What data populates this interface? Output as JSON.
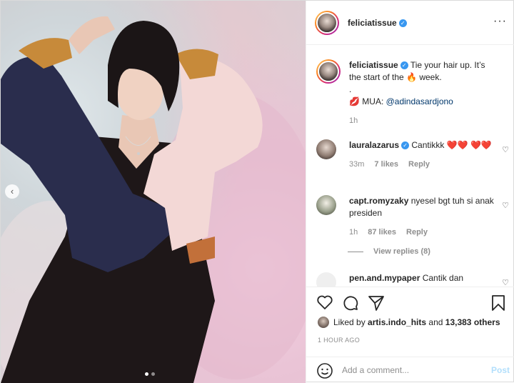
{
  "post": {
    "username": "feliciatissue",
    "verified": true,
    "more_icon": "more-dots-icon",
    "carousel_prev": "‹",
    "carousel_dots": 2,
    "carousel_active_index": 0
  },
  "caption": {
    "username": "feliciatissue",
    "text": "Tie your hair up. It’s the start of the 🔥 week.",
    "dot": ".",
    "mua_prefix": "💋 MUA: ",
    "mua_handle": "@adindasardjono",
    "time": "1h"
  },
  "comments": [
    {
      "username": "lauralazarus",
      "verified": true,
      "text": "Cantikkk ❤️❤️ ❤️❤️",
      "time": "33m",
      "likes": "7 likes",
      "reply": "Reply"
    },
    {
      "username": "capt.romyzaky",
      "verified": false,
      "text": "nyesel bgt tuh si anak presiden",
      "time": "1h",
      "likes": "87 likes",
      "reply": "Reply",
      "view_replies": "View replies (8)"
    },
    {
      "username": "pen.and.mypaper",
      "verified": false,
      "text": "Cantik dan"
    }
  ],
  "actions": {
    "likes_prefix": "Liked by ",
    "liked_by": "artis.indo_hits",
    "likes_suffix": " and ",
    "others": "13,383 others",
    "time_ago": "1 HOUR AGO"
  },
  "add_comment": {
    "placeholder": "Add a comment...",
    "post_label": "Post"
  },
  "colors": {
    "accent_link": "#00376b",
    "verified": "#3897f0",
    "post_disabled": "#b2dffc",
    "heart_red": "#ed4956"
  }
}
